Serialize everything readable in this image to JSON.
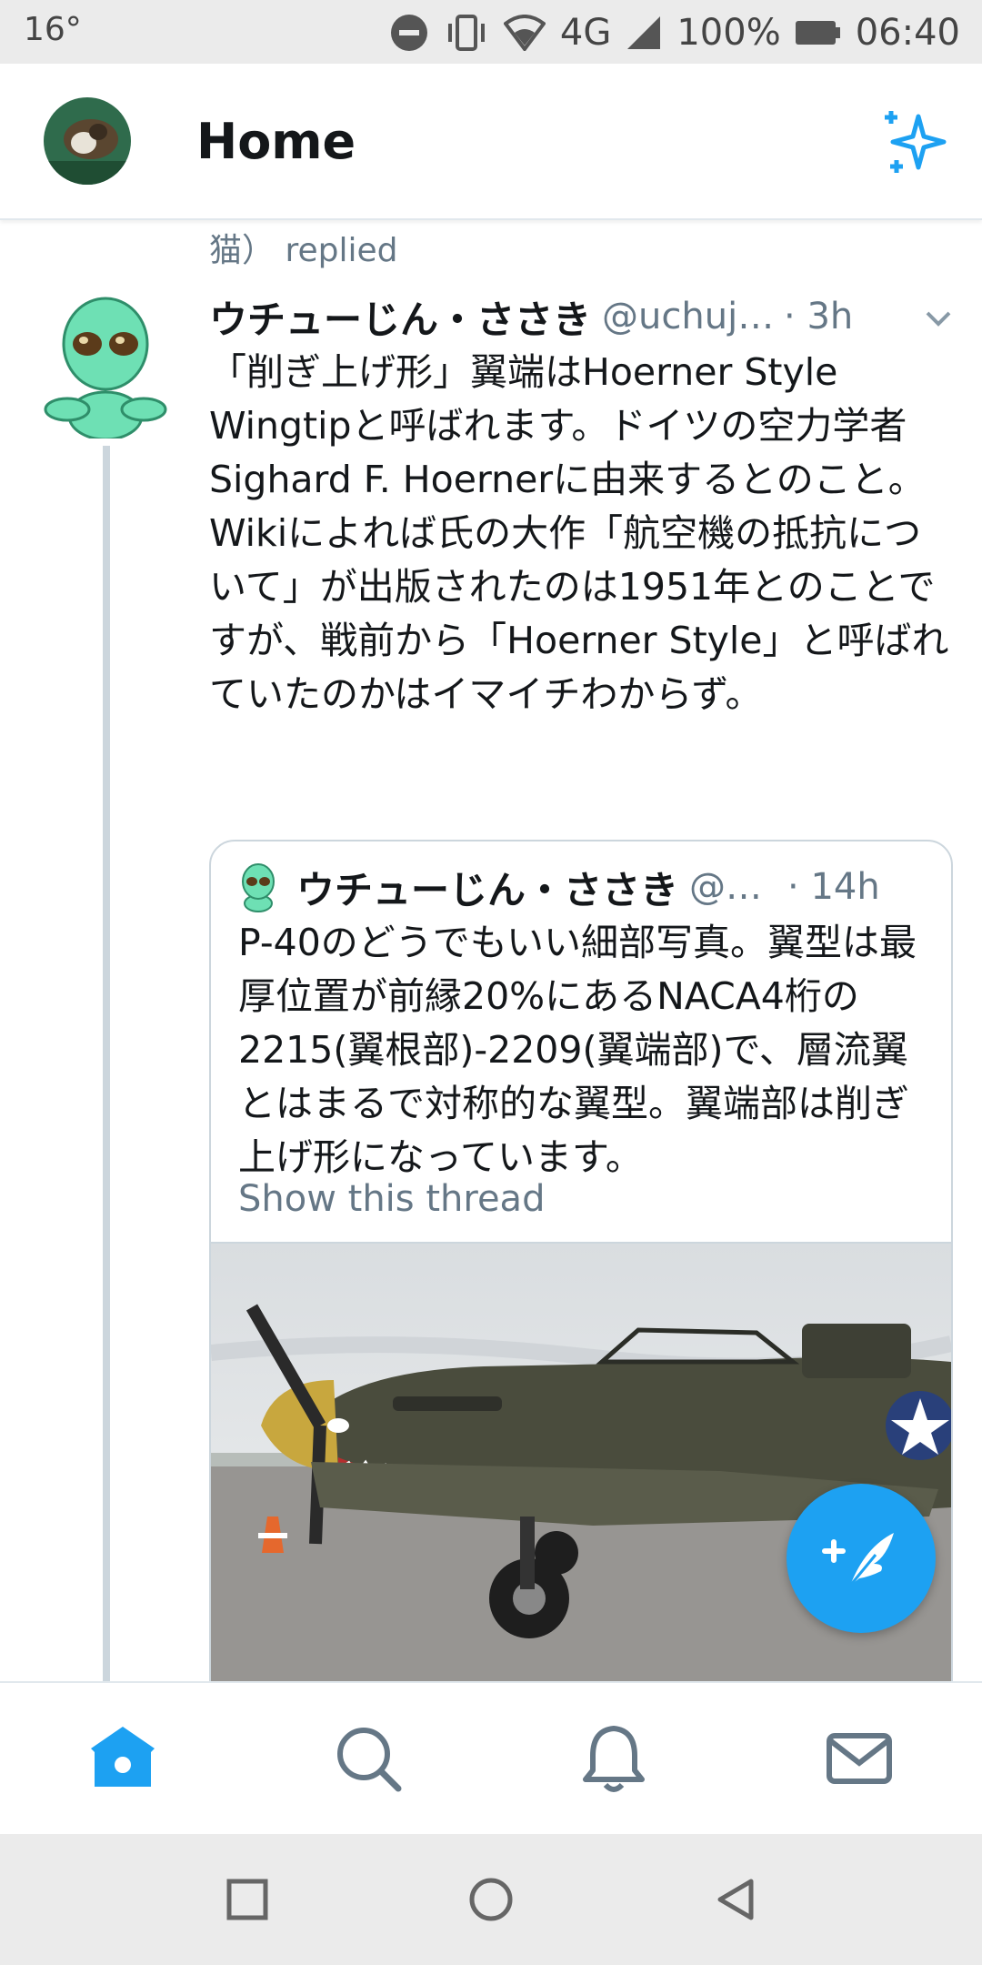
{
  "status_bar": {
    "temperature": "16°",
    "network": "4G",
    "battery": "100%",
    "time": "06:40",
    "icons": [
      "dnd-icon",
      "vibrate-icon",
      "wifi-icon",
      "signal-icon",
      "battery-icon"
    ]
  },
  "header": {
    "title": "Home",
    "sparkle_icon": "sparkle-icon",
    "accent_color": "#1da1f2"
  },
  "feed": {
    "context_label": "猫） replied",
    "tweet": {
      "author": "ウチューじん・ささき",
      "handle": "@uchuji...",
      "time": "· 3h",
      "text": "「削ぎ上げ形」翼端はHoerner Style Wingtipと呼ばれます。ドイツの空力学者\nSighard F. Hoernerに由来するとのこと。Wikiによれば氏の大作「航空機の抵抗について」が出版されたのは1951年とのことですが、戦前から「Hoerner Style」と呼ばれていたのかはイマイチわからず。"
    },
    "quoted_tweet": {
      "author": "ウチューじん・ささき",
      "handle": "@u...",
      "time": "· 14h",
      "text": "P-40のどうでもいい細部写真。翼型は最厚位置が前縁20%にあるNACA4桁の2215(翼根部)-2209(翼端部)で、層流翼とはまるで対称的な翼型。翼端部は削ぎ上げ形になっています。",
      "link": "Show this thread"
    }
  },
  "bottom_nav": {
    "items": [
      "home-icon",
      "search-icon",
      "notifications-icon",
      "messages-icon"
    ]
  },
  "system_nav": {
    "items": [
      "recents-icon",
      "home-circle-icon",
      "back-icon"
    ]
  }
}
